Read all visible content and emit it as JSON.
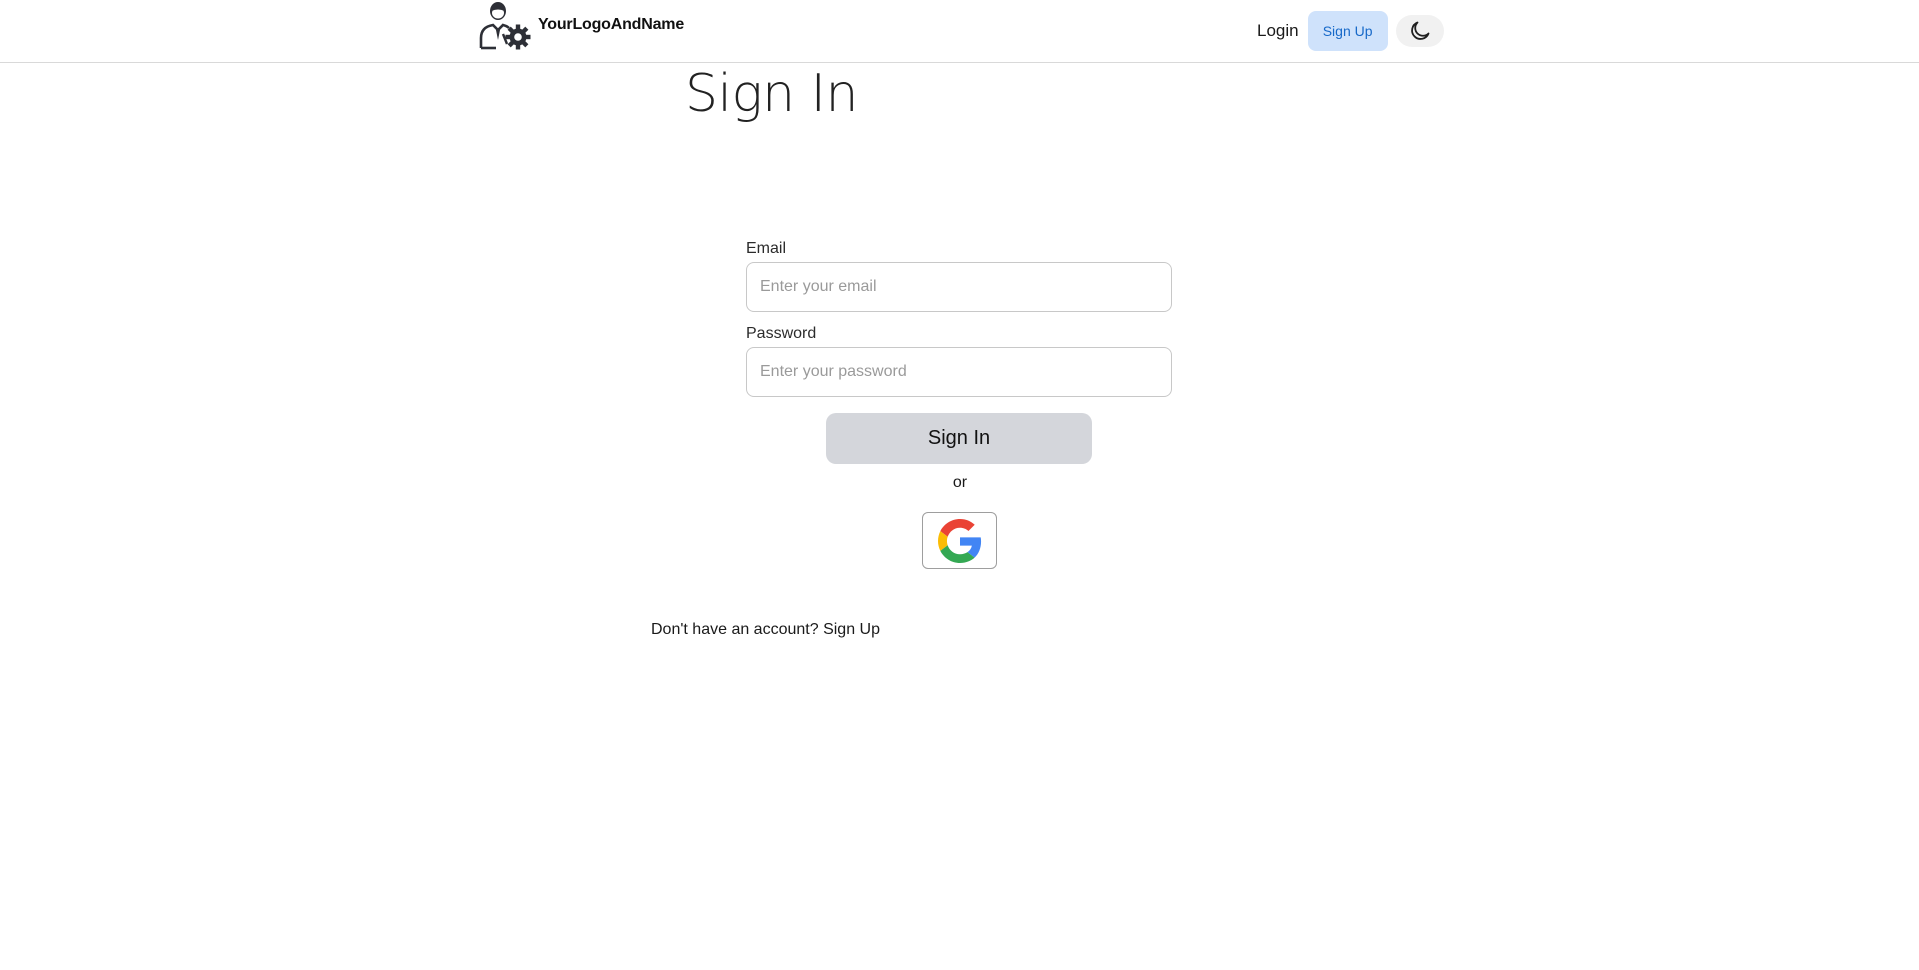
{
  "nav": {
    "brand_name": "YourLogoAndName",
    "login_label": "Login",
    "signup_label": "Sign Up",
    "theme_icon": "moon-icon"
  },
  "page": {
    "title": "Sign In"
  },
  "form": {
    "email": {
      "label": "Email",
      "placeholder": "Enter your email",
      "value": ""
    },
    "password": {
      "label": "Password",
      "placeholder": "Enter your password",
      "value": ""
    },
    "submit_label": "Sign In",
    "divider_text": "or",
    "google_icon": "google-icon"
  },
  "footer": {
    "prompt_text": "Don't have an account?",
    "signup_link": "Sign Up"
  },
  "colors": {
    "signup_bg": "#cfe2fb",
    "signup_text": "#1769c9",
    "submit_bg": "#d4d6db",
    "google_blue": "#4285F4",
    "google_red": "#EA4335",
    "google_yellow": "#FBBC05",
    "google_green": "#34A853"
  }
}
